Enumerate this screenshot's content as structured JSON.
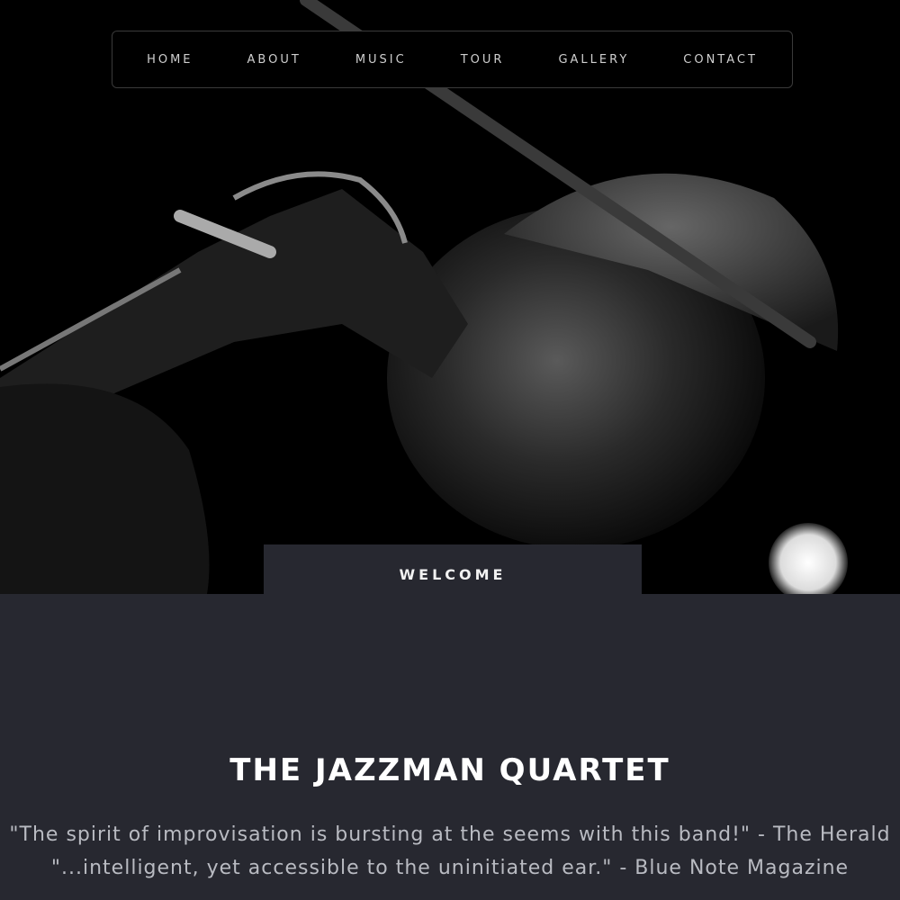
{
  "nav": {
    "items": [
      {
        "label": "HOME"
      },
      {
        "label": "ABOUT"
      },
      {
        "label": "MUSIC"
      },
      {
        "label": "TOUR"
      },
      {
        "label": "GALLERY"
      },
      {
        "label": "CONTACT"
      }
    ]
  },
  "hero": {
    "image": "saxophone-player-photo"
  },
  "welcome": {
    "label": "WELCOME"
  },
  "main": {
    "title": "THE JAZZMAN QUARTET",
    "quotes": [
      "\"The spirit of improvisation is bursting at the seems with this band!\" - The Herald",
      "\"...intelligent, yet accessible to the uninitiated ear.\" - Blue Note Magazine"
    ]
  },
  "colors": {
    "background": "#000000",
    "panel": "#272830",
    "text": "#ffffff",
    "muted": "#b9bbc2"
  }
}
